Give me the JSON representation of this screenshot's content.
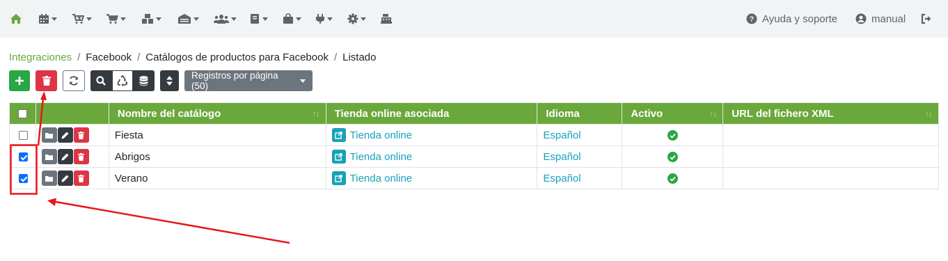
{
  "nav": {
    "icons": [
      "home-icon",
      "calendar-icon",
      "cart-plus-icon",
      "cart-icon",
      "warehouse-boxes-icon",
      "warehouse-icon",
      "users-icon",
      "book-icon",
      "shopping-bag-icon",
      "plug-icon",
      "gear-icon",
      "cash-register-icon"
    ],
    "help_label": "Ayuda y soporte",
    "user_label": "manual"
  },
  "breadcrumb": {
    "items": [
      "Integraciones",
      "Facebook",
      "Catálogos de productos para Facebook",
      "Listado"
    ]
  },
  "toolbar": {
    "per_page_label": "Registros por página (50)"
  },
  "table": {
    "headers": {
      "name": "Nombre del catálogo",
      "store": "Tienda online asociada",
      "language": "Idioma",
      "active": "Activo",
      "xml_url": "URL del fichero XML"
    },
    "rows": [
      {
        "checked": false,
        "name": "Fiesta",
        "store": "Tienda online",
        "language": "Español",
        "active": true,
        "xml_url": ""
      },
      {
        "checked": true,
        "name": "Abrigos",
        "store": "Tienda online",
        "language": "Español",
        "active": true,
        "xml_url": ""
      },
      {
        "checked": true,
        "name": "Verano",
        "store": "Tienda online",
        "language": "Español",
        "active": true,
        "xml_url": ""
      }
    ]
  },
  "colors": {
    "accent_green": "#6aa83b",
    "danger_red": "#dc3545",
    "link_teal": "#17a2b8",
    "annotation_red": "#e8161a"
  }
}
